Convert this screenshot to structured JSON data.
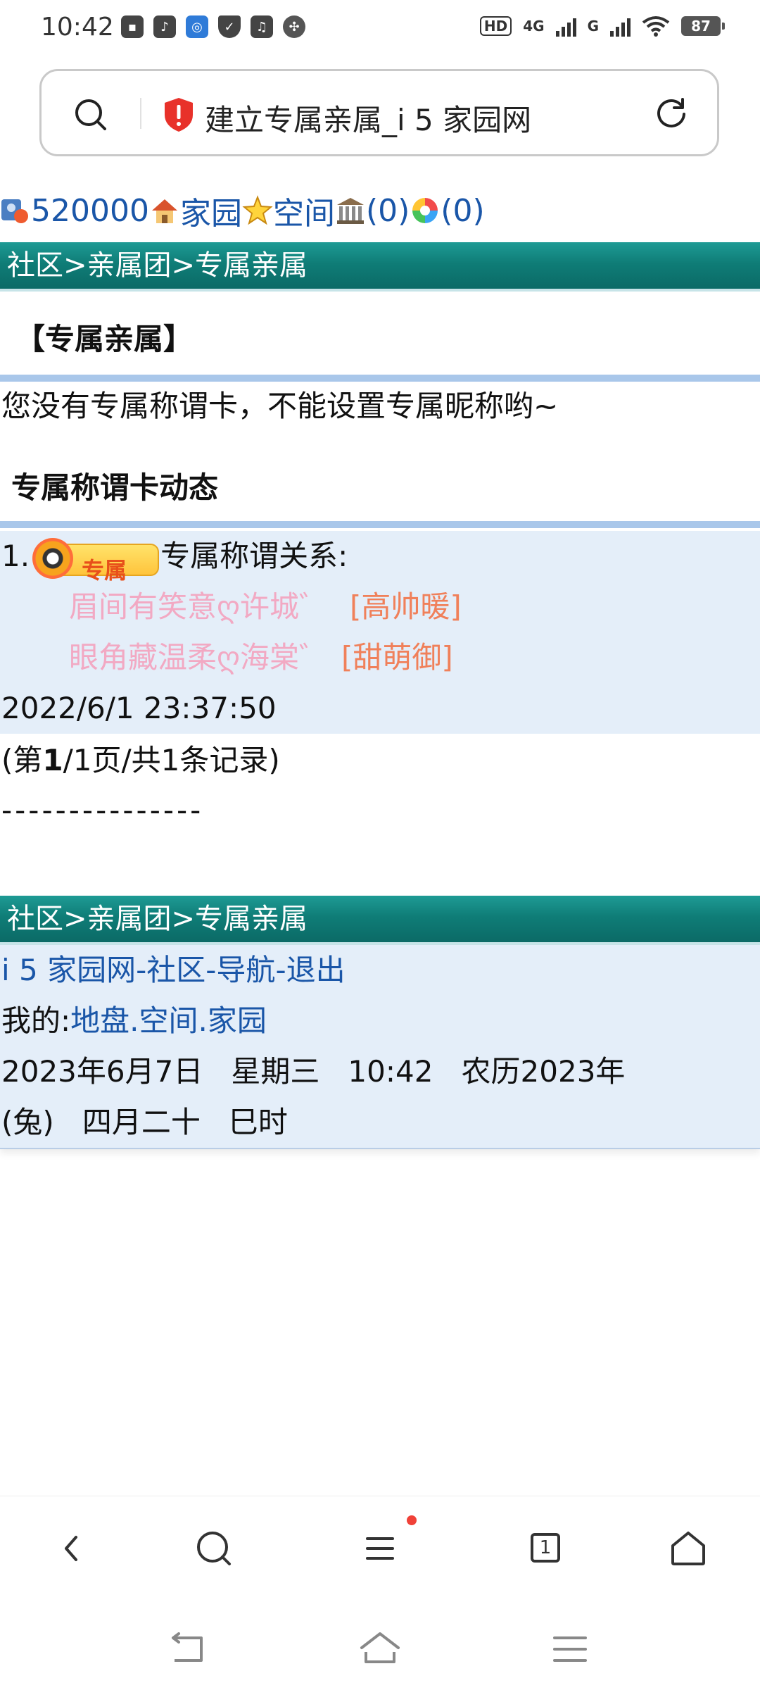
{
  "status_bar": {
    "time": "10:42",
    "left_icons": [
      "message-icon",
      "tiktok-icon",
      "app-icon",
      "shield-icon",
      "music-icon",
      "fan-icon"
    ],
    "network_1": "HD",
    "network_2": "4G",
    "network_3": "G",
    "battery": "87"
  },
  "address_bar": {
    "title": "建立专属亲属_i 5 家园网",
    "security_icon": "shield-warning-icon",
    "search_icon": "search-icon",
    "reload_icon": "reload-icon"
  },
  "top_nav": {
    "points": "520000",
    "home_link": "家园",
    "space_link": "空间",
    "bank_count": "(0)",
    "photo_count": "(0)"
  },
  "breadcrumb": "社区>亲属团>专属亲属",
  "page_title": "【专属亲属】",
  "notice": "您没有专属称谓卡，不能设置专属昵称哟~",
  "dynamics_title": "专属称谓卡动态",
  "record": {
    "index": "1.",
    "badge_text": "专属",
    "label": "专属称谓关系:",
    "relations": [
      {
        "name": "眉间有笑意ღ许城゛",
        "title": "[高帅暖]"
      },
      {
        "name": "眼角藏温柔ღ海棠゛",
        "title": "[甜萌御]"
      }
    ],
    "datetime": "2022/6/1 23:37:50"
  },
  "pagination": {
    "prefix": "(第",
    "current": "1",
    "rest": "/1页/共1条记录)"
  },
  "separator": "---------------",
  "footer": {
    "breadcrumb": "社区>亲属团>专属亲属",
    "site_link": "i 5 家园网",
    "community_link": "社区",
    "nav_link": "导航",
    "logout_link": "退出",
    "dash": "-",
    "mine_label": "我的:",
    "land_link": "地盘",
    "space_link": "空间",
    "home_link": "家园",
    "dot": ".",
    "date_line_1": "2023年6月7日   星期三   10:42   农历2023年",
    "date_line_2": "(兔)   四月二十   巳时"
  },
  "bottom_nav": {
    "items": [
      "back-icon",
      "search-icon",
      "menu-icon",
      "tabs-icon",
      "home-icon"
    ],
    "tabs_count": "1"
  },
  "colors": {
    "link": "#1a56a8",
    "teal": "#0f7d77",
    "card": "#e4eef9",
    "rule": "#a9c7ea",
    "relation_name": "#f2a9c3",
    "relation_tag": "#f0805a"
  }
}
